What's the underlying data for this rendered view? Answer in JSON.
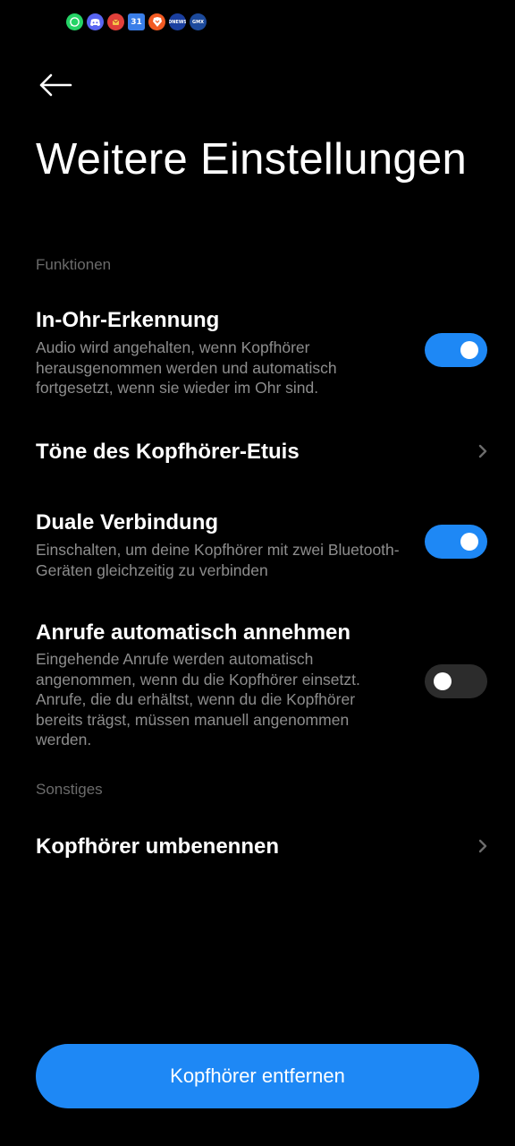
{
  "status_bar": {
    "icons": [
      "whatsapp-icon",
      "discord-icon",
      "red-app-icon",
      "calendar-icon",
      "brave-icon",
      "news-icon",
      "gmx-icon"
    ],
    "calendar_day": "31",
    "news_text": "DNEWS",
    "gmx_text": "GMX"
  },
  "header": {
    "back_icon": "arrow-left-icon",
    "title": "Weitere Einstellungen"
  },
  "sections": {
    "functions_label": "Funktionen",
    "other_label": "Sonstiges"
  },
  "settings": {
    "in_ear": {
      "title": "In-Ohr-Erkennung",
      "description": "Audio wird angehalten, wenn Kopfhörer herausgenommen werden und automatisch fortgesetzt, wenn sie wieder im Ohr sind.",
      "enabled": true
    },
    "case_tones": {
      "title": "Töne des Kopfhörer-Etuis"
    },
    "dual_connection": {
      "title": "Duale Verbindung",
      "description": "Einschalten, um deine Kopfhörer mit zwei Bluetooth-Geräten gleichzeitig zu verbinden",
      "enabled": true
    },
    "auto_answer": {
      "title": "Anrufe automatisch annehmen",
      "description": "Eingehende Anrufe werden automatisch angenommen, wenn du die Kopfhörer einsetzt. Anrufe, die du erhältst, wenn du die Kopfhörer bereits trägst, müssen manuell angenommen werden.",
      "enabled": false
    },
    "rename": {
      "title": "Kopfhörer umbenennen"
    }
  },
  "footer": {
    "remove_button": "Kopfhörer entfernen"
  },
  "colors": {
    "accent": "#1e88f5",
    "background": "#000000",
    "toggle_off": "#2c2c2c",
    "secondary_text": "#8d8d8d",
    "section_label": "#6b6b6b"
  }
}
